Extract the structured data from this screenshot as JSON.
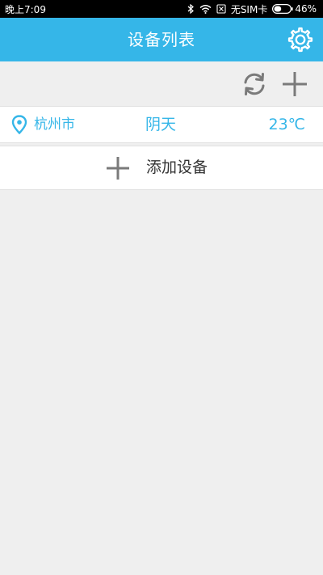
{
  "status_bar": {
    "time": "晚上7:09",
    "carrier": "无SIM卡",
    "battery": "46%",
    "battery_level": 0.46
  },
  "header": {
    "title": "设备列表",
    "settings_icon": "gear-icon"
  },
  "toolbar": {
    "refresh_icon": "refresh-icon",
    "add_icon": "plus-icon"
  },
  "weather": {
    "city": "杭州市",
    "condition": "阴天",
    "temperature": "23℃",
    "location_icon": "location-pin-icon"
  },
  "add_device": {
    "label": "添加设备",
    "icon": "plus-icon"
  },
  "colors": {
    "accent": "#35b6e8",
    "background": "#efefef",
    "row_bg": "#ffffff",
    "icon_gray": "#7a7a7a",
    "text_dark": "#333333"
  }
}
